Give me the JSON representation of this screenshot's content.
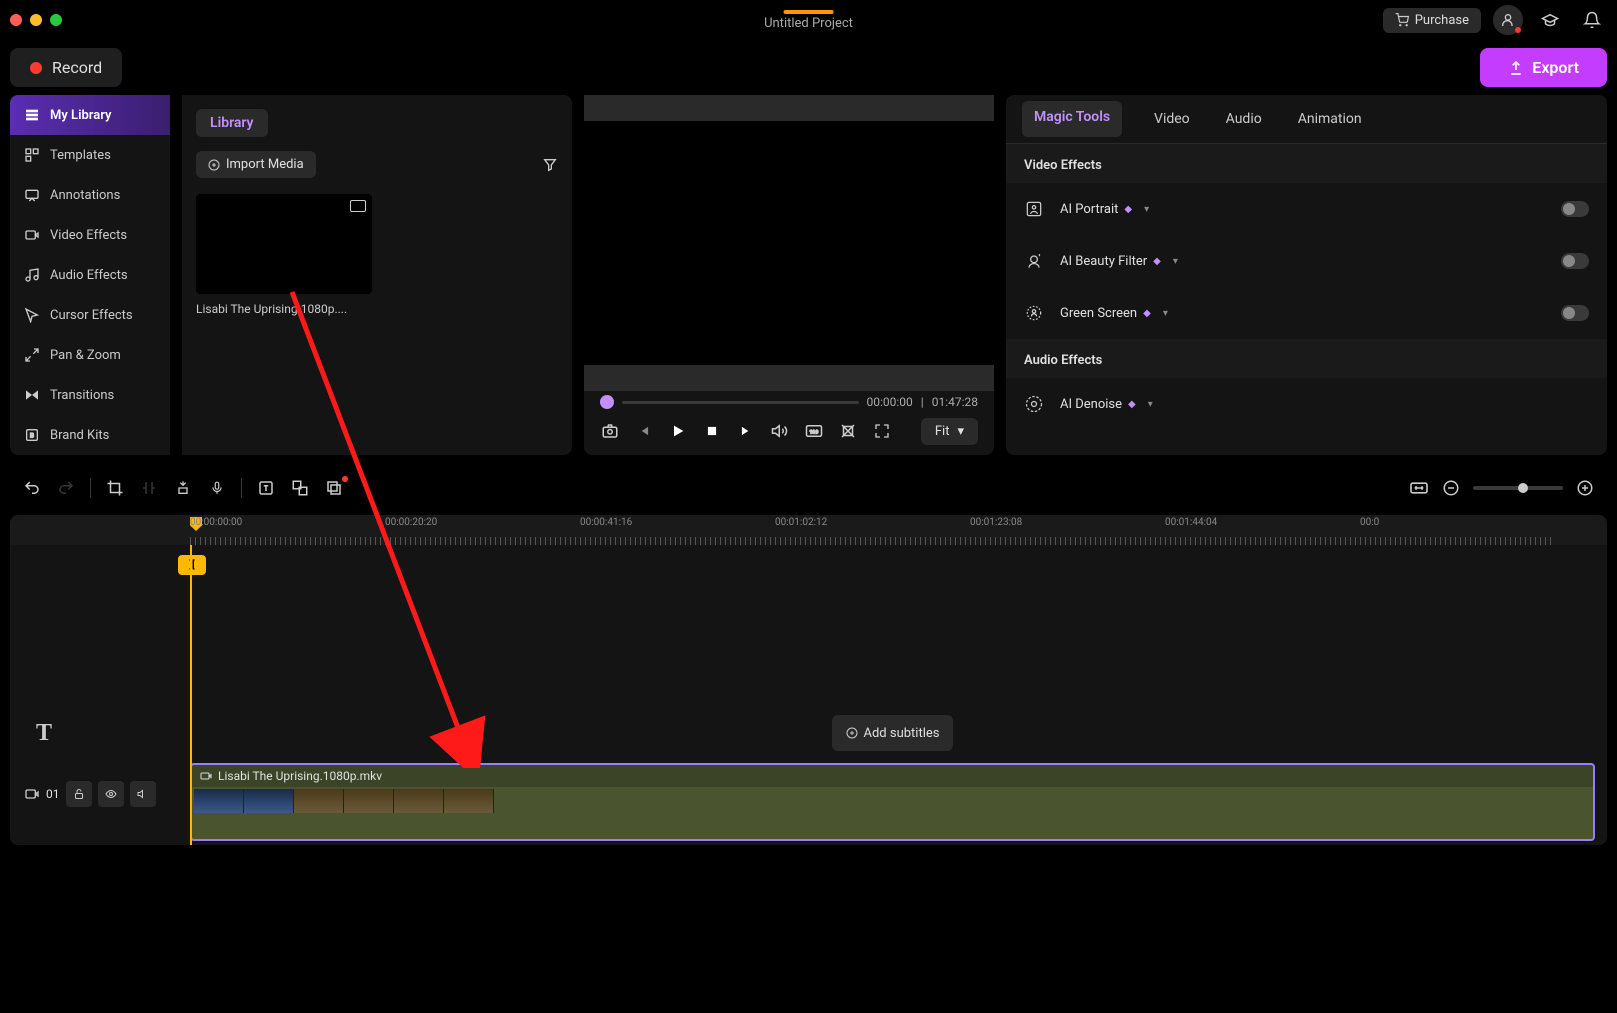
{
  "title": "Untitled Project",
  "header": {
    "purchase": "Purchase",
    "record": "Record",
    "export": "Export"
  },
  "sidebar": {
    "items": [
      {
        "label": "My Library",
        "icon": "library"
      },
      {
        "label": "Templates",
        "icon": "templates"
      },
      {
        "label": "Annotations",
        "icon": "annotations"
      },
      {
        "label": "Video Effects",
        "icon": "video-fx"
      },
      {
        "label": "Audio Effects",
        "icon": "audio-fx"
      },
      {
        "label": "Cursor Effects",
        "icon": "cursor-fx"
      },
      {
        "label": "Pan & Zoom",
        "icon": "pan-zoom"
      },
      {
        "label": "Transitions",
        "icon": "transitions"
      },
      {
        "label": "Brand Kits",
        "icon": "brand"
      }
    ]
  },
  "library": {
    "tab": "Library",
    "import": "Import Media",
    "items": [
      {
        "name": "Lisabi The Uprising.1080p...."
      }
    ]
  },
  "preview": {
    "current_time": "00:00:00",
    "total_time": "01:47:28",
    "fit": "Fit"
  },
  "props": {
    "tabs": [
      "Magic Tools",
      "Video",
      "Audio",
      "Animation"
    ],
    "video_section": "Video Effects",
    "audio_section": "Audio Effects",
    "effects": [
      {
        "label": "AI Portrait",
        "premium": true
      },
      {
        "label": "AI Beauty Filter",
        "premium": true
      },
      {
        "label": "Green Screen",
        "premium": true
      }
    ],
    "audio_effects": [
      {
        "label": "AI Denoise",
        "premium": true
      }
    ]
  },
  "timeline": {
    "ruler": [
      "00:00:00:00",
      "00:00:20:20",
      "00:00:41:16",
      "00:01:02:12",
      "00:01:23:08",
      "00:01:44:04",
      "00:0"
    ],
    "add_subtitles": "Add subtitles",
    "track_number": "01",
    "clip_name": "Lisabi The Uprising.1080p.mkv"
  }
}
